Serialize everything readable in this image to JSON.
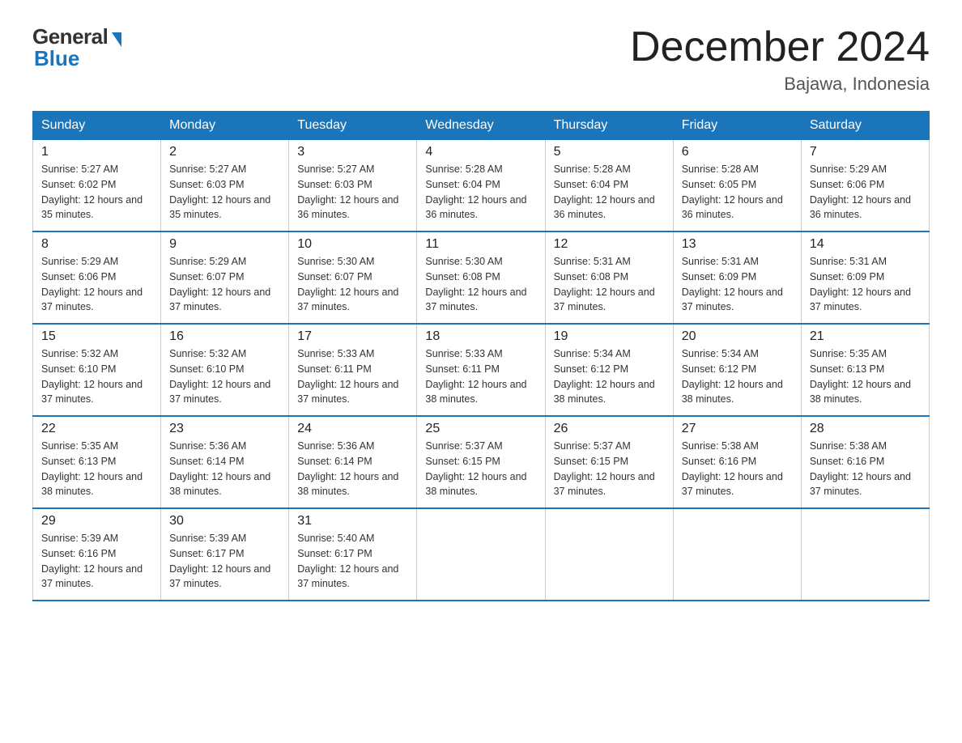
{
  "header": {
    "logo_general": "General",
    "logo_blue": "Blue",
    "title": "December 2024",
    "location": "Bajawa, Indonesia"
  },
  "columns": [
    "Sunday",
    "Monday",
    "Tuesday",
    "Wednesday",
    "Thursday",
    "Friday",
    "Saturday"
  ],
  "weeks": [
    [
      {
        "day": "1",
        "sunrise": "5:27 AM",
        "sunset": "6:02 PM",
        "daylight": "12 hours and 35 minutes."
      },
      {
        "day": "2",
        "sunrise": "5:27 AM",
        "sunset": "6:03 PM",
        "daylight": "12 hours and 35 minutes."
      },
      {
        "day": "3",
        "sunrise": "5:27 AM",
        "sunset": "6:03 PM",
        "daylight": "12 hours and 36 minutes."
      },
      {
        "day": "4",
        "sunrise": "5:28 AM",
        "sunset": "6:04 PM",
        "daylight": "12 hours and 36 minutes."
      },
      {
        "day": "5",
        "sunrise": "5:28 AM",
        "sunset": "6:04 PM",
        "daylight": "12 hours and 36 minutes."
      },
      {
        "day": "6",
        "sunrise": "5:28 AM",
        "sunset": "6:05 PM",
        "daylight": "12 hours and 36 minutes."
      },
      {
        "day": "7",
        "sunrise": "5:29 AM",
        "sunset": "6:06 PM",
        "daylight": "12 hours and 36 minutes."
      }
    ],
    [
      {
        "day": "8",
        "sunrise": "5:29 AM",
        "sunset": "6:06 PM",
        "daylight": "12 hours and 37 minutes."
      },
      {
        "day": "9",
        "sunrise": "5:29 AM",
        "sunset": "6:07 PM",
        "daylight": "12 hours and 37 minutes."
      },
      {
        "day": "10",
        "sunrise": "5:30 AM",
        "sunset": "6:07 PM",
        "daylight": "12 hours and 37 minutes."
      },
      {
        "day": "11",
        "sunrise": "5:30 AM",
        "sunset": "6:08 PM",
        "daylight": "12 hours and 37 minutes."
      },
      {
        "day": "12",
        "sunrise": "5:31 AM",
        "sunset": "6:08 PM",
        "daylight": "12 hours and 37 minutes."
      },
      {
        "day": "13",
        "sunrise": "5:31 AM",
        "sunset": "6:09 PM",
        "daylight": "12 hours and 37 minutes."
      },
      {
        "day": "14",
        "sunrise": "5:31 AM",
        "sunset": "6:09 PM",
        "daylight": "12 hours and 37 minutes."
      }
    ],
    [
      {
        "day": "15",
        "sunrise": "5:32 AM",
        "sunset": "6:10 PM",
        "daylight": "12 hours and 37 minutes."
      },
      {
        "day": "16",
        "sunrise": "5:32 AM",
        "sunset": "6:10 PM",
        "daylight": "12 hours and 37 minutes."
      },
      {
        "day": "17",
        "sunrise": "5:33 AM",
        "sunset": "6:11 PM",
        "daylight": "12 hours and 37 minutes."
      },
      {
        "day": "18",
        "sunrise": "5:33 AM",
        "sunset": "6:11 PM",
        "daylight": "12 hours and 38 minutes."
      },
      {
        "day": "19",
        "sunrise": "5:34 AM",
        "sunset": "6:12 PM",
        "daylight": "12 hours and 38 minutes."
      },
      {
        "day": "20",
        "sunrise": "5:34 AM",
        "sunset": "6:12 PM",
        "daylight": "12 hours and 38 minutes."
      },
      {
        "day": "21",
        "sunrise": "5:35 AM",
        "sunset": "6:13 PM",
        "daylight": "12 hours and 38 minutes."
      }
    ],
    [
      {
        "day": "22",
        "sunrise": "5:35 AM",
        "sunset": "6:13 PM",
        "daylight": "12 hours and 38 minutes."
      },
      {
        "day": "23",
        "sunrise": "5:36 AM",
        "sunset": "6:14 PM",
        "daylight": "12 hours and 38 minutes."
      },
      {
        "day": "24",
        "sunrise": "5:36 AM",
        "sunset": "6:14 PM",
        "daylight": "12 hours and 38 minutes."
      },
      {
        "day": "25",
        "sunrise": "5:37 AM",
        "sunset": "6:15 PM",
        "daylight": "12 hours and 38 minutes."
      },
      {
        "day": "26",
        "sunrise": "5:37 AM",
        "sunset": "6:15 PM",
        "daylight": "12 hours and 37 minutes."
      },
      {
        "day": "27",
        "sunrise": "5:38 AM",
        "sunset": "6:16 PM",
        "daylight": "12 hours and 37 minutes."
      },
      {
        "day": "28",
        "sunrise": "5:38 AM",
        "sunset": "6:16 PM",
        "daylight": "12 hours and 37 minutes."
      }
    ],
    [
      {
        "day": "29",
        "sunrise": "5:39 AM",
        "sunset": "6:16 PM",
        "daylight": "12 hours and 37 minutes."
      },
      {
        "day": "30",
        "sunrise": "5:39 AM",
        "sunset": "6:17 PM",
        "daylight": "12 hours and 37 minutes."
      },
      {
        "day": "31",
        "sunrise": "5:40 AM",
        "sunset": "6:17 PM",
        "daylight": "12 hours and 37 minutes."
      },
      null,
      null,
      null,
      null
    ]
  ]
}
